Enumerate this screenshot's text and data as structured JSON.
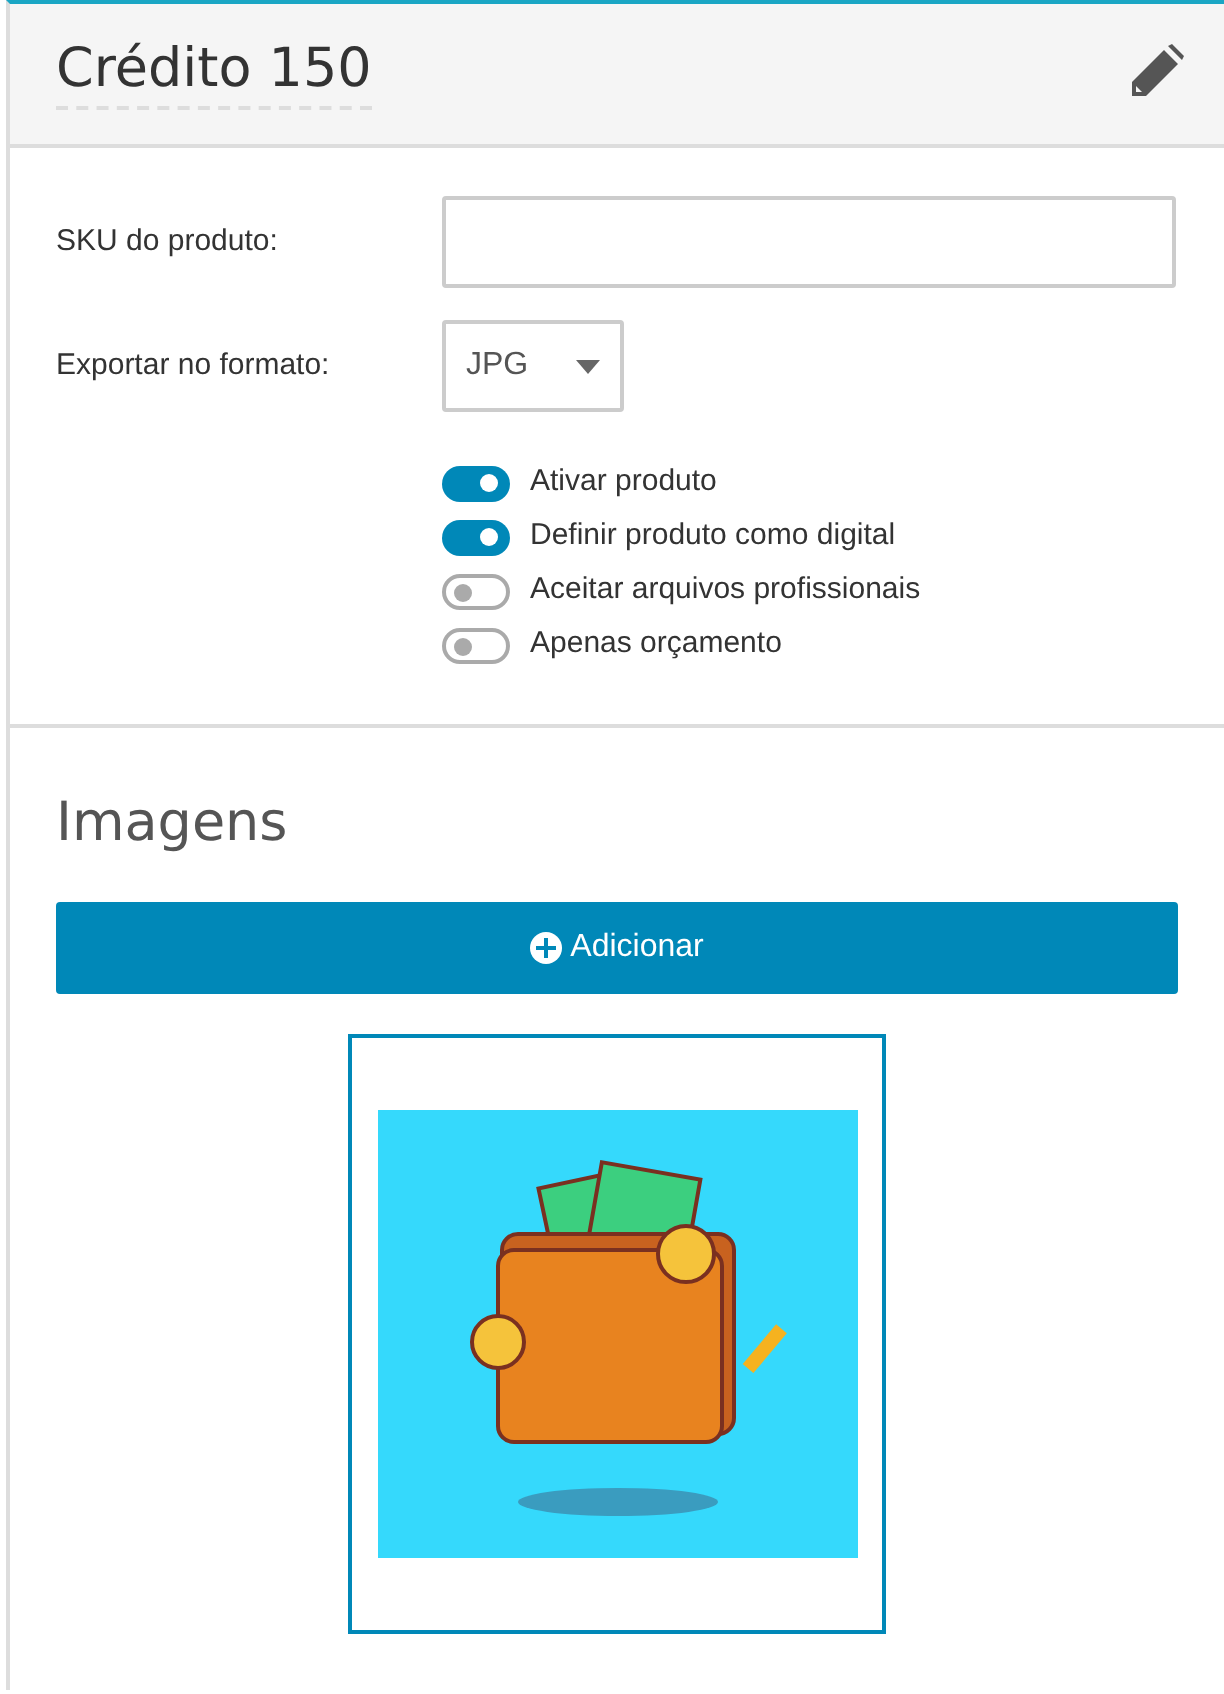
{
  "header": {
    "title": "Crédito 150"
  },
  "form": {
    "sku": {
      "label": "SKU do produto:"
    },
    "format": {
      "label": "Exportar no formato:",
      "value": "JPG"
    },
    "toggles": [
      {
        "label": "Ativar produto",
        "on": true
      },
      {
        "label": "Definir produto como digital",
        "on": true
      },
      {
        "label": "Aceitar arquivos profissionais",
        "on": false
      },
      {
        "label": "Apenas orçamento",
        "on": false
      }
    ]
  },
  "images": {
    "title": "Imagens",
    "add_button": "Adicionar"
  }
}
